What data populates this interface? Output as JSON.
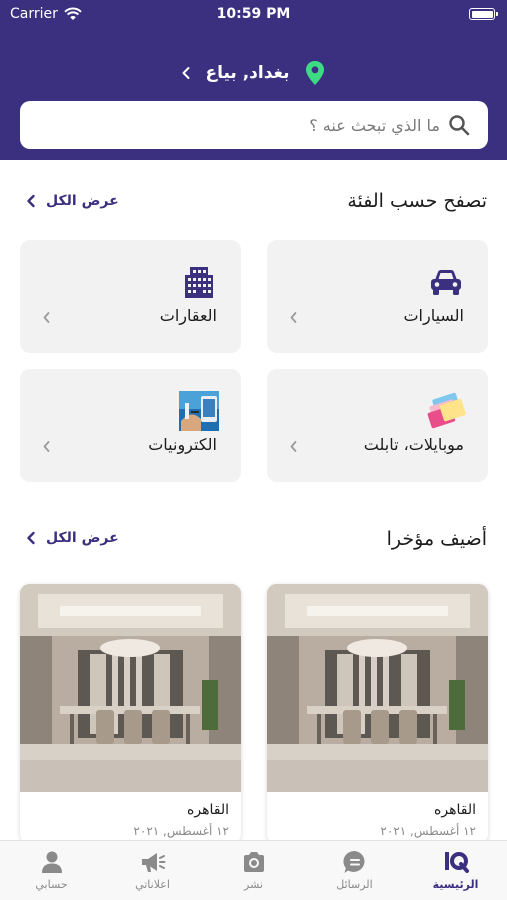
{
  "status_bar": {
    "carrier": "Carrier",
    "time": "10:59 PM"
  },
  "header": {
    "location": "بغداد, بياع"
  },
  "search": {
    "placeholder": "ما الذي تبحث عنه ؟"
  },
  "categories_section": {
    "title": "تصفح حسب الفئة",
    "view_all": "عرض الكل",
    "items": [
      {
        "label": "السيارات",
        "icon": "car-icon"
      },
      {
        "label": "العقارات",
        "icon": "building-icon"
      },
      {
        "label": "موبايلات، تابلت",
        "icon": "phones-icon"
      },
      {
        "label": "الكترونيات",
        "icon": "electronics-icon"
      }
    ]
  },
  "recent_section": {
    "title": "أضيف مؤخرا",
    "view_all": "عرض الكل",
    "listings": [
      {
        "city": "القاهره",
        "date": "١٢ أغسطس, ٢٠٢١"
      },
      {
        "city": "القاهره",
        "date": "١٢ أغسطس, ٢٠٢١"
      }
    ]
  },
  "tab_bar": {
    "items": [
      {
        "label": "الرئيسية",
        "icon": "iq-home-icon",
        "active": true
      },
      {
        "label": "الرسائل",
        "icon": "chat-icon"
      },
      {
        "label": "نشر",
        "icon": "camera-icon"
      },
      {
        "label": "اعلاناتي",
        "icon": "megaphone-icon"
      },
      {
        "label": "حسابي",
        "icon": "user-icon"
      }
    ]
  },
  "colors": {
    "brand": "#3b2f80",
    "accent": "#3ddc84",
    "card_bg": "#f2f2f2"
  }
}
